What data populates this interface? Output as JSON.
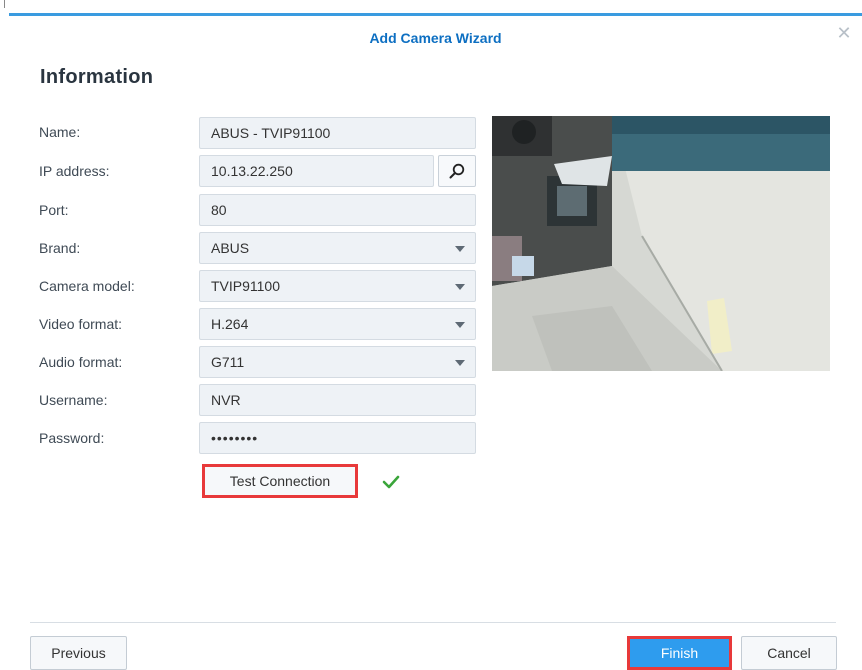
{
  "dialog": {
    "title": "Add Camera Wizard",
    "close_icon": "close-icon",
    "heading": "Information"
  },
  "form": {
    "name": {
      "label": "Name:",
      "value": "ABUS - TVIP91100"
    },
    "ip": {
      "label": "IP address:",
      "value": "10.13.22.250",
      "search_icon": "search-icon"
    },
    "port": {
      "label": "Port:",
      "value": "80"
    },
    "brand": {
      "label": "Brand:",
      "value": "ABUS"
    },
    "model": {
      "label": "Camera model:",
      "value": "TVIP91100"
    },
    "video": {
      "label": "Video format:",
      "value": "H.264"
    },
    "audio": {
      "label": "Audio format:",
      "value": "G711"
    },
    "username": {
      "label": "Username:",
      "value": "NVR"
    },
    "password": {
      "label": "Password:",
      "value": "••••••••"
    }
  },
  "test_connection": {
    "label": "Test Connection",
    "status_icon": "check-icon",
    "status_color": "#3aa53a"
  },
  "footer": {
    "previous": "Previous",
    "finish": "Finish",
    "cancel": "Cancel"
  },
  "colors": {
    "accent": "#2e9cee",
    "title": "#0d6fc2",
    "highlight": "#e8393a"
  }
}
